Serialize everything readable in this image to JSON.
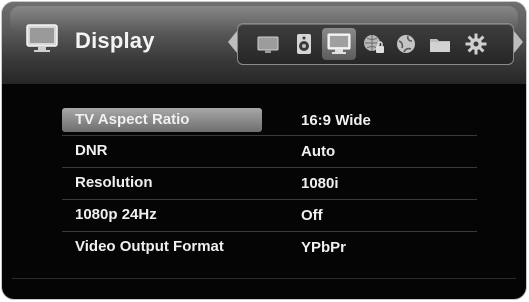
{
  "header": {
    "title": "Display",
    "title_icon": "tv-icon",
    "tabs": [
      {
        "icon": "tv-icon",
        "active": false
      },
      {
        "icon": "speaker-icon",
        "active": false
      },
      {
        "icon": "display-icon",
        "active": true
      },
      {
        "icon": "globe-lock-icon",
        "active": false
      },
      {
        "icon": "network-icon",
        "active": false
      },
      {
        "icon": "folder-icon",
        "active": false
      },
      {
        "icon": "gear-icon",
        "active": false
      }
    ]
  },
  "settings": [
    {
      "label": "TV Aspect Ratio",
      "value": "16:9 Wide",
      "selected": true
    },
    {
      "label": "DNR",
      "value": "Auto",
      "selected": false
    },
    {
      "label": "Resolution",
      "value": "1080i",
      "selected": false
    },
    {
      "label": "1080p 24Hz",
      "value": "Off",
      "selected": false
    },
    {
      "label": "Video Output Format",
      "value": "YPbPr",
      "selected": false
    }
  ],
  "colors": {
    "background": "#050505",
    "header": "#5a5a5a",
    "highlight": "#8c8c8c",
    "text": "#f0f0f0"
  }
}
